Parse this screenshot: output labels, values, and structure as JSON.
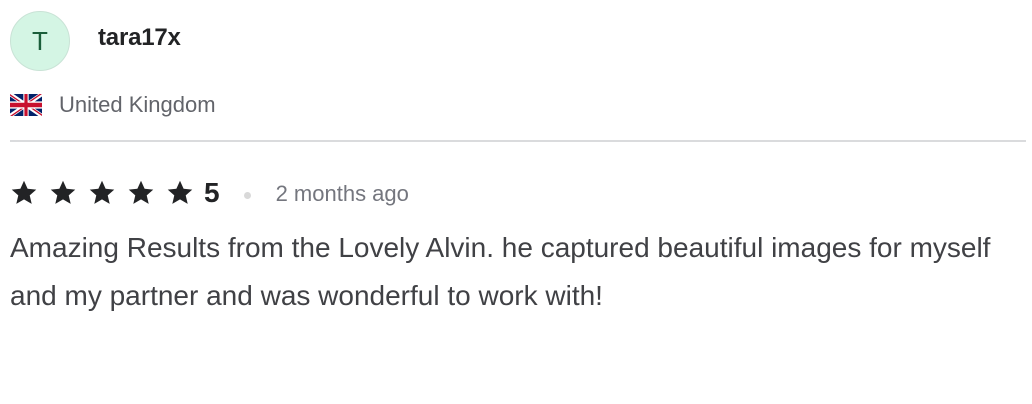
{
  "reviewer": {
    "avatar_letter": "T",
    "username": "tara17x",
    "country": "United Kingdom",
    "flag_icon": "uk-flag-icon"
  },
  "rating": {
    "stars": 5,
    "value": "5",
    "date": "2 months ago"
  },
  "review": {
    "text": "Amazing Results from the Lovely Alvin. he captured beautiful images for myself and my partner and was wonderful to work with!"
  },
  "colors": {
    "avatar_bg": "#d4f5e4",
    "avatar_text": "#1b5e3a",
    "star": "#222325",
    "muted_text": "#62646a",
    "divider": "#dadbdd"
  }
}
